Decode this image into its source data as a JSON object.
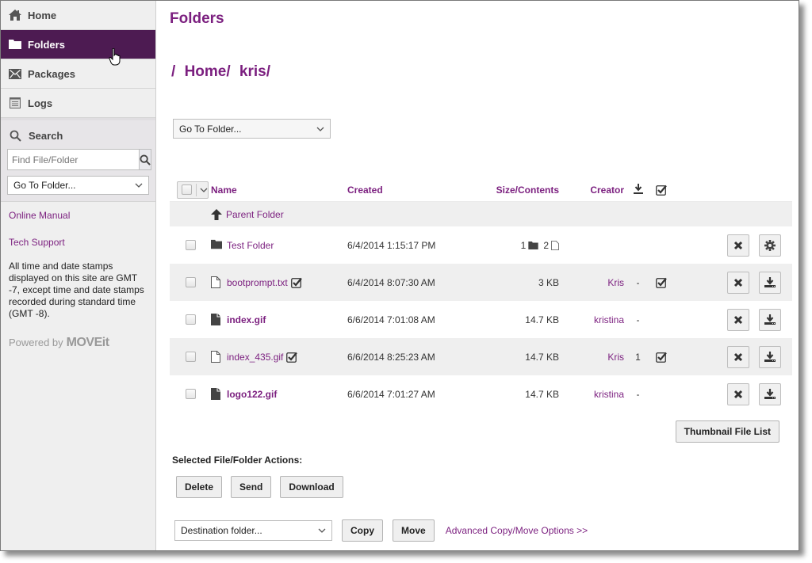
{
  "sidebar": {
    "nav": [
      {
        "label": "Home",
        "icon": "home-icon",
        "active": false
      },
      {
        "label": "Folders",
        "icon": "folder-icon",
        "active": true
      },
      {
        "label": "Packages",
        "icon": "envelope-icon",
        "active": false
      },
      {
        "label": "Logs",
        "icon": "log-icon",
        "active": false
      }
    ],
    "search": {
      "title": "Search",
      "placeholder": "Find File/Folder",
      "goto_value": "Go To Folder..."
    },
    "links": {
      "manual": "Online Manual",
      "support": "Tech Support"
    },
    "note": "All time and date stamps displayed on this site are GMT -7, except time and date stamps recorded during standard time (GMT -8).",
    "powered_by": "Powered by",
    "brand": "MOVEit"
  },
  "main": {
    "title": "Folders",
    "breadcrumb": [
      "/",
      "Home/",
      "kris/"
    ],
    "goto_value": "Go To Folder...",
    "columns": {
      "name": "Name",
      "created": "Created",
      "size": "Size/Contents",
      "creator": "Creator",
      "download_icon": "download-icon",
      "checked_icon": "checkbox-checked-icon"
    },
    "parent_folder": "Parent Folder",
    "rows": [
      {
        "type": "folder",
        "name": "Test Folder",
        "created": "6/4/2014 1:15:17 PM",
        "folders": "1",
        "files": "2",
        "creator": "",
        "downloads": "",
        "checked": false,
        "action2": "settings"
      },
      {
        "type": "file-new",
        "name": "bootprompt.txt",
        "name_checked": true,
        "created": "6/4/2014 8:07:30 AM",
        "size": "3 KB",
        "creator": "Kris",
        "downloads": "-",
        "checked": true,
        "action2": "download"
      },
      {
        "type": "file",
        "name": "index.gif",
        "name_checked": false,
        "created": "6/6/2014 7:01:08 AM",
        "size": "14.7 KB",
        "creator": "kristina",
        "downloads": "-",
        "checked": false,
        "action2": "download"
      },
      {
        "type": "file-new",
        "name": "index_435.gif",
        "name_checked": true,
        "created": "6/6/2014 8:25:23 AM",
        "size": "14.7 KB",
        "creator": "Kris",
        "downloads": "1",
        "checked": true,
        "action2": "download"
      },
      {
        "type": "file",
        "name": "logo122.gif",
        "name_checked": false,
        "created": "6/6/2014 7:01:27 AM",
        "size": "14.7 KB",
        "creator": "kristina",
        "downloads": "-",
        "checked": false,
        "action2": "download"
      }
    ],
    "thumbnail_button": "Thumbnail File List",
    "selected_actions_label": "Selected File/Folder Actions:",
    "actions": {
      "delete": "Delete",
      "send": "Send",
      "download": "Download"
    },
    "destination_value": "Destination folder...",
    "copy": "Copy",
    "move": "Move",
    "advanced_link": "Advanced Copy/Move Options >>"
  },
  "colors": {
    "accent": "#7b1f7f",
    "nav_active": "#4d1b52",
    "sidebar_bg": "#efefef"
  }
}
